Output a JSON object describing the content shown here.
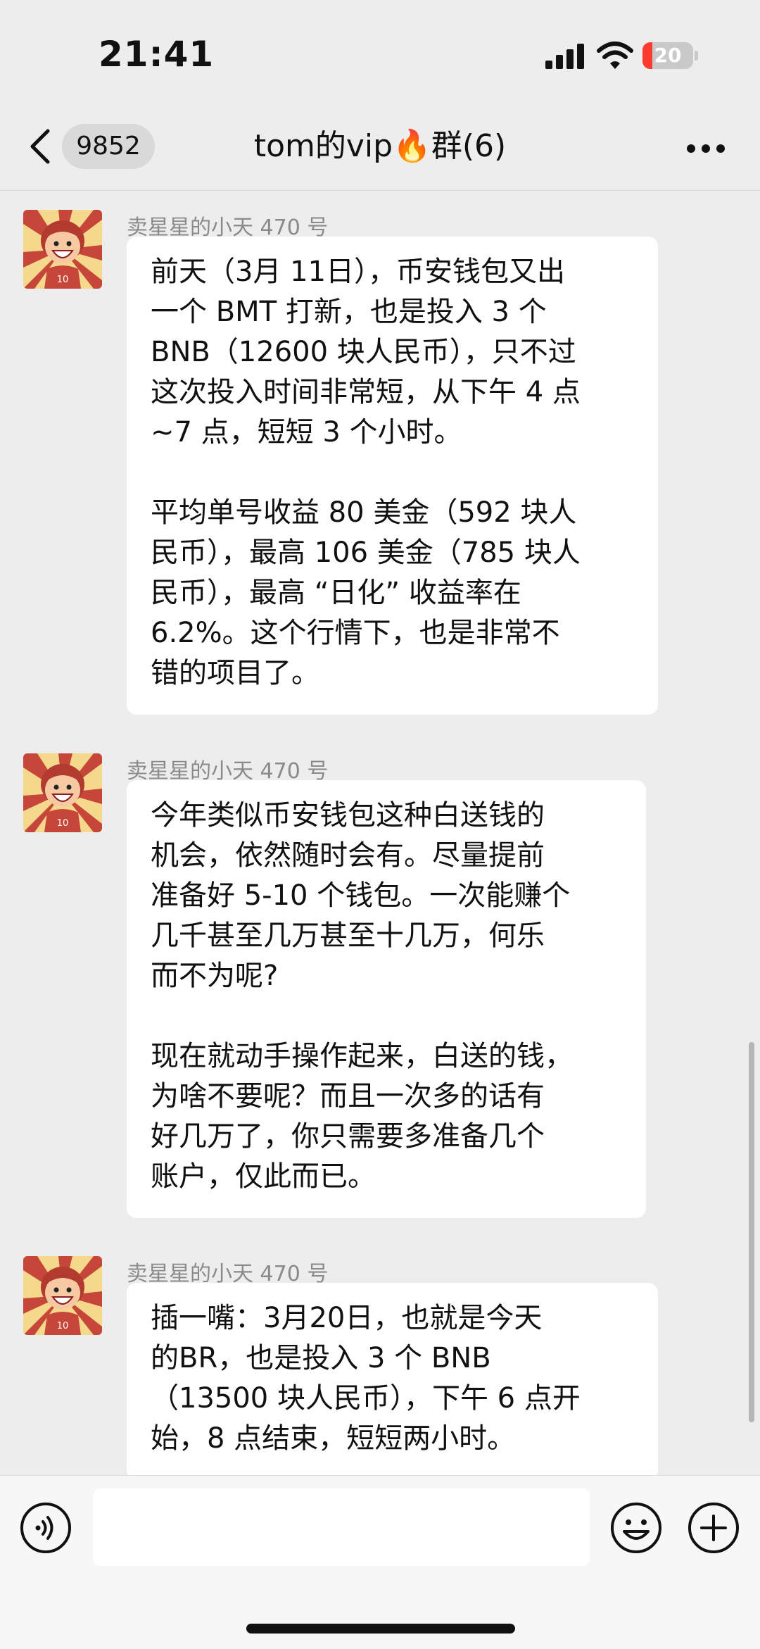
{
  "status_bar": {
    "time": "21:41",
    "battery": "20",
    "battery_level": 0.2,
    "battery_color": "#ff3b30"
  },
  "nav": {
    "back_icon": "chevron-left-icon",
    "unread_count": "9852",
    "title": "tom的vip🔥群(6)",
    "more_icon": "more-horizontal-icon"
  },
  "messages": [
    {
      "sender": "卖星星的小天 470 号",
      "paragraphs": [
        [
          "前天（3月 11日），币安钱包又出",
          "一个 BMT 打新，也是投入 3 个",
          "BNB（12600 块人民币），只不过",
          "这次投入时间非常短，从下午 4 点",
          "~7 点，短短 3 个小时。"
        ],
        [
          "平均单号收益 80 美金（592 块人",
          "民币），最高 106 美金（785 块人",
          "民币），最高 “日化” 收益率在",
          "6.2%。这个行情下，也是非常不",
          "错的项目了。"
        ]
      ]
    },
    {
      "sender": "卖星星的小天 470 号",
      "paragraphs": [
        [
          "今年类似币安钱包这种白送钱的",
          "机会，依然随时会有。尽量提前",
          "准备好 5-10 个钱包。一次能赚个",
          "几千甚至几万甚至十几万，何乐",
          "而不为呢?"
        ],
        [
          "现在就动手操作起来，白送的钱，",
          "为啥不要呢？而且一次多的话有",
          "好几万了，你只需要多准备几个",
          "账户，仅此而已。"
        ]
      ]
    },
    {
      "sender": "卖星星的小天 470 号",
      "paragraphs": [
        [
          "插一嘴：3月20日，也就是今天",
          "的BR，也是投入 3 个 BNB",
          "（13500 块人民币），下午 6 点开",
          "始，8 点结束，短短两小时。"
        ]
      ]
    }
  ],
  "input_bar": {
    "voice_icon": "voice-icon",
    "input_value": "",
    "emoji_icon": "emoji-icon",
    "plus_icon": "plus-circle-icon"
  }
}
